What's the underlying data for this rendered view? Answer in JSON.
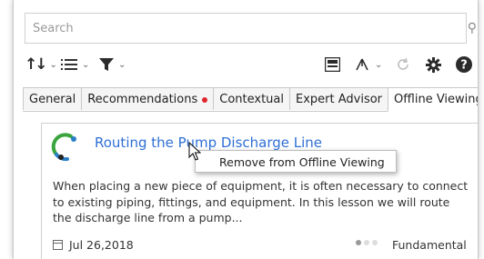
{
  "search": {
    "placeholder": "Search"
  },
  "tabs": [
    {
      "label": "General"
    },
    {
      "label": "Recommendations",
      "badge": "red-dot"
    },
    {
      "label": "Contextual"
    },
    {
      "label": "Expert Advisor"
    },
    {
      "label": "Offline Viewing",
      "active": true
    }
  ],
  "card": {
    "title": "Routing the Pump Discharge Line",
    "description": "When placing a new piece of equipment, it is often necessary to connect to existing piping, fittings, and equipment. In this lesson we will route the discharge line from a pump...",
    "date": "Jul 26,2018",
    "level": "Fundamental",
    "level_dots_filled": 1,
    "level_dots_total": 3
  },
  "context_menu": {
    "item": "Remove from Offline Viewing"
  },
  "colors": {
    "link": "#2f6fd6",
    "badge": "#e0262d"
  },
  "icons": [
    "search-icon",
    "sort-icon",
    "list-icon",
    "filter-icon",
    "save-icon",
    "tree-icon",
    "refresh-icon",
    "gear-icon",
    "help-icon",
    "calendar-icon",
    "mouse-cursor-icon"
  ]
}
